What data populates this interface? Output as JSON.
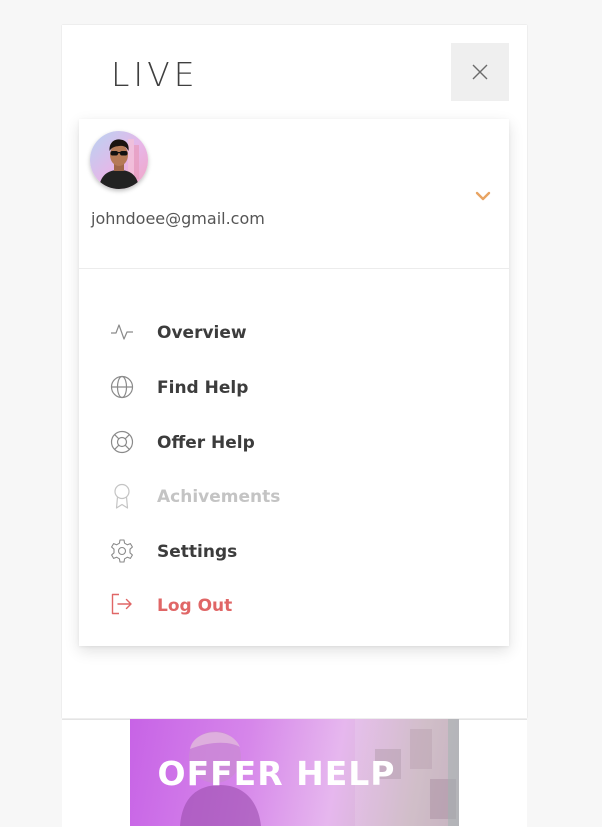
{
  "app": {
    "logo_text": "LIVE"
  },
  "profile": {
    "email": "johndoee@gmail.com"
  },
  "menu": {
    "items": [
      {
        "label": "Overview",
        "icon": "activity-icon",
        "state": "normal"
      },
      {
        "label": "Find Help",
        "icon": "globe-icon",
        "state": "normal"
      },
      {
        "label": "Offer Help",
        "icon": "lifebuoy-icon",
        "state": "normal"
      },
      {
        "label": "Achivements",
        "icon": "award-icon",
        "state": "disabled"
      },
      {
        "label": "Settings",
        "icon": "gear-icon",
        "state": "normal"
      },
      {
        "label": "Log Out",
        "icon": "logout-icon",
        "state": "danger"
      }
    ]
  },
  "promo": {
    "title": "OFFER HELP"
  },
  "colors": {
    "accent": "#e8a463",
    "danger": "#e06666",
    "text": "#3c3c3c",
    "muted": "#c4c4c4",
    "icon": "#8a8a8a",
    "promo_gradient_start": "#c763e6"
  }
}
